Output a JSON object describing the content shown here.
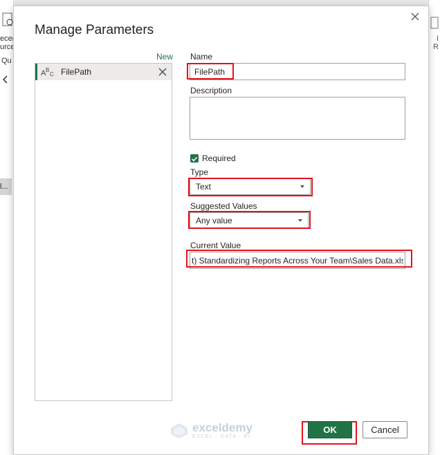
{
  "background": {
    "left_fragments": [
      "ecen",
      "urce",
      "Qu",
      "l..."
    ],
    "right_fragments": [
      "I",
      "R"
    ]
  },
  "dialog": {
    "title": "Manage Parameters",
    "new_link": "New",
    "parameters": [
      {
        "icon": "abc-text-type-icon",
        "label": "FilePath"
      }
    ],
    "fields": {
      "name_label": "Name",
      "name_value": "FilePath",
      "description_label": "Description",
      "description_value": "",
      "required_label": "Required",
      "required_checked": true,
      "type_label": "Type",
      "type_value": "Text",
      "suggested_label": "Suggested Values",
      "suggested_value": "Any value",
      "current_label": "Current Value",
      "current_value": "t) Standardizing Reports Across Your Team\\Sales Data.xlsx"
    },
    "buttons": {
      "ok": "OK",
      "cancel": "Cancel"
    }
  },
  "watermark": {
    "brand": "exceldemy",
    "sub": "EXCEL · DATA · BI"
  },
  "colors": {
    "accent": "#217346",
    "highlight": "#e3121b"
  }
}
